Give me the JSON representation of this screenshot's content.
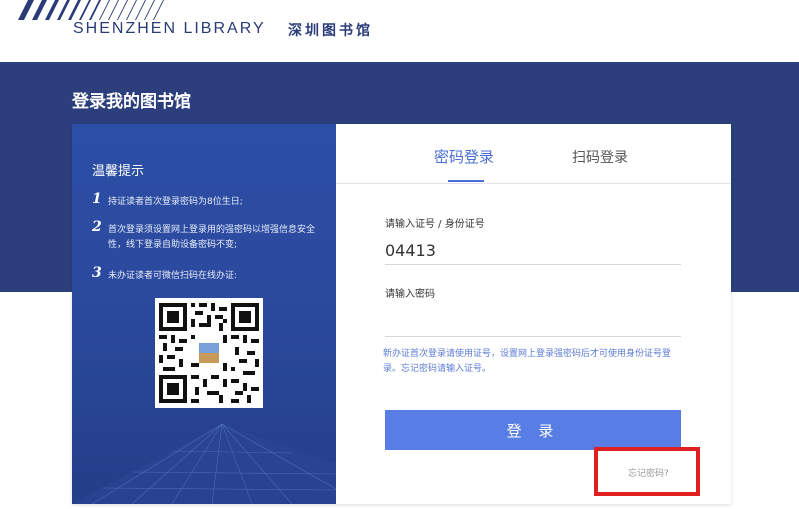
{
  "header": {
    "logo_en": "SHENZHEN LIBRARY",
    "logo_cn": "深圳图书馆"
  },
  "page_title": "登录我的图书馆",
  "tips": {
    "title": "温馨提示",
    "items": [
      {
        "num": "1",
        "text": "持证读者首次登录密码为8位生日;"
      },
      {
        "num": "2",
        "text": "首次登录须设置网上登录用的强密码以增强信息安全性，线下登录自助设备密码不变;"
      },
      {
        "num": "3",
        "text": "未办证读者可微信扫码在线办证:"
      }
    ]
  },
  "tabs": {
    "password_login": "密码登录",
    "scan_login": "扫码登录"
  },
  "form": {
    "id_label": "请输入证号 / 身份证号",
    "id_value": "04413",
    "password_label": "请输入密码",
    "password_value": "",
    "notice": "新办证首次登录请使用证号，设置网上登录强密码后才可使用身份证号登录。忘记密码请输入证号。",
    "login_button": "登 录",
    "forgot_password": "忘记密码?"
  },
  "colors": {
    "brand_dark": "#2c3f7c",
    "accent": "#4b6ed6",
    "button": "#587ee6",
    "highlight": "#e02020"
  }
}
